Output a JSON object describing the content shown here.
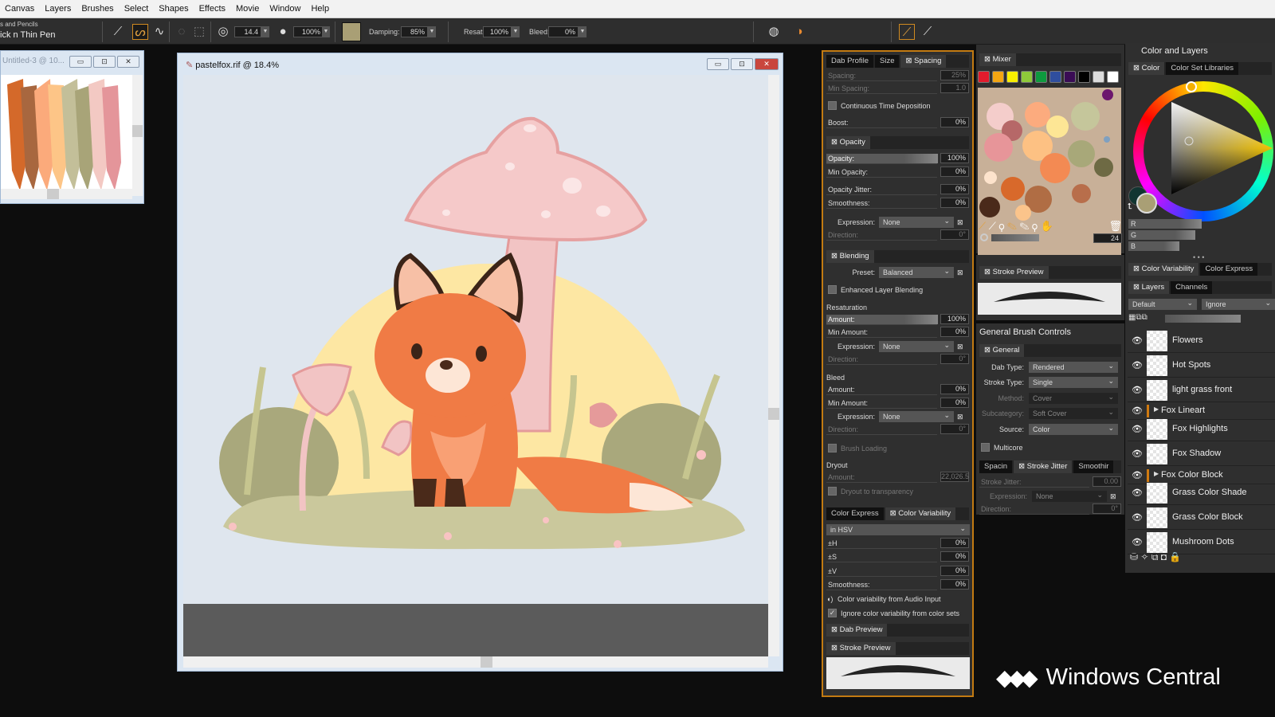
{
  "menu": [
    "Canvas",
    "Layers",
    "Brushes",
    "Select",
    "Shapes",
    "Effects",
    "Movie",
    "Window",
    "Help"
  ],
  "toolbar": {
    "brush_category": "s and Pencils",
    "brush_variant": "ick n Thin Pen",
    "size": "14.4",
    "opacity": "100%",
    "damping_label": "Damping:",
    "damping": "85%",
    "resat_label": "Resat:",
    "resat": "100%",
    "bleed_label": "Bleed:",
    "bleed": "0%",
    "current_color": "#a99f75"
  },
  "small_window": {
    "title": "Untitled-3 @ 10...",
    "strokes": [
      "#d4692a",
      "#a8673f",
      "#fbaa7b",
      "#fdc587",
      "#c3bf99",
      "#a8a478",
      "#f3c9c3",
      "#e4959a"
    ]
  },
  "main_window": {
    "title": "pastelfox.rif @ 18.4%"
  },
  "brush_panel": {
    "rows": [
      {
        "t": "tabs",
        "tabs": [
          "Dab Profile",
          "Size",
          "Spacing"
        ],
        "active": 2
      },
      {
        "t": "field",
        "label": "Spacing:",
        "value": "25%",
        "dim": true
      },
      {
        "t": "field",
        "label": "Min Spacing:",
        "value": "1.0",
        "dim": true
      },
      {
        "t": "check",
        "label": "Continuous Time Deposition"
      },
      {
        "t": "field",
        "label": "Boost:",
        "value": "0%"
      },
      {
        "t": "tabs",
        "tabs": [
          "Opacity"
        ],
        "active": 0
      },
      {
        "t": "slider",
        "label": "Opacity:",
        "value": "100%",
        "fill": 1
      },
      {
        "t": "field",
        "label": "Min Opacity:",
        "value": "0%"
      },
      {
        "t": "field",
        "label": "Opacity Jitter:",
        "value": "0%"
      },
      {
        "t": "field",
        "label": "Smoothness:",
        "value": "0%"
      },
      {
        "t": "select",
        "label": "Expression:",
        "value": "None"
      },
      {
        "t": "field",
        "label": "Direction:",
        "value": "0°",
        "dim": true
      },
      {
        "t": "tabs",
        "tabs": [
          "Blending"
        ],
        "active": 0
      },
      {
        "t": "select",
        "label": "Preset:",
        "value": "Balanced"
      },
      {
        "t": "check",
        "label": "Enhanced Layer Blending"
      },
      {
        "t": "heading",
        "label": "Resaturation"
      },
      {
        "t": "slider",
        "label": "Amount:",
        "value": "100%",
        "fill": 1
      },
      {
        "t": "field",
        "label": "Min Amount:",
        "value": "0%"
      },
      {
        "t": "select",
        "label": "Expression:",
        "value": "None"
      },
      {
        "t": "field",
        "label": "Direction:",
        "value": "0°",
        "dim": true
      },
      {
        "t": "heading",
        "label": "Bleed"
      },
      {
        "t": "field",
        "label": "Amount:",
        "value": "0%"
      },
      {
        "t": "field",
        "label": "Min Amount:",
        "value": "0%"
      },
      {
        "t": "select",
        "label": "Expression:",
        "value": "None"
      },
      {
        "t": "field",
        "label": "Direction:",
        "value": "0°",
        "dim": true
      },
      {
        "t": "check",
        "label": "Brush Loading",
        "dim": true
      },
      {
        "t": "heading",
        "label": "Dryout"
      },
      {
        "t": "field",
        "label": "Amount:",
        "value": "22,026.5",
        "dim": true
      },
      {
        "t": "check",
        "label": "Dryout to transparency",
        "dim": true
      },
      {
        "t": "tabs",
        "tabs": [
          "Color Express",
          "Color Variability"
        ],
        "active": 1
      },
      {
        "t": "select",
        "label": "",
        "value": "in HSV"
      },
      {
        "t": "field",
        "label": "±H",
        "value": "0%"
      },
      {
        "t": "field",
        "label": "±S",
        "value": "0%"
      },
      {
        "t": "field",
        "label": "±V",
        "value": "0%"
      },
      {
        "t": "field",
        "label": "Smoothness:",
        "value": "0%"
      },
      {
        "t": "audio",
        "label": "Color variability from Audio Input"
      },
      {
        "t": "check",
        "label": "Ignore color variability from color sets",
        "checked": true
      },
      {
        "t": "tabs",
        "tabs": [
          "Dab Preview"
        ],
        "active": 0
      },
      {
        "t": "tabs",
        "tabs": [
          "Stroke Preview"
        ],
        "active": 0
      }
    ]
  },
  "mixer": {
    "tab": "Mixer",
    "swatches": [
      "#e21b2c",
      "#f3a512",
      "#f8ee00",
      "#8fc93a",
      "#0e9a3e",
      "#2f4e9e",
      "#3a0c55",
      "#000000",
      "#dcdcdc",
      "#ffffff"
    ],
    "brush_size": "24",
    "stroke_preview_tab": "Stroke Preview"
  },
  "general": {
    "title": "General Brush Controls",
    "rows": [
      {
        "t": "tabs",
        "tabs": [
          "General"
        ],
        "active": 0
      },
      {
        "t": "gselect",
        "label": "Dab Type:",
        "value": "Rendered"
      },
      {
        "t": "gselect",
        "label": "Stroke Type:",
        "value": "Single"
      },
      {
        "t": "gselect",
        "label": "Method:",
        "value": "Cover",
        "dim": true
      },
      {
        "t": "gselect",
        "label": "Subcategory:",
        "value": "Soft Cover",
        "dim": true
      },
      {
        "t": "gselect",
        "label": "Source:",
        "value": "Color"
      },
      {
        "t": "check",
        "label": "Multicore"
      },
      {
        "t": "tabs",
        "tabs": [
          "Spacin",
          "Stroke Jitter",
          "Smoothir"
        ],
        "active": 1
      },
      {
        "t": "field",
        "label": "Stroke Jitter:",
        "value": "0.00",
        "dim": true
      },
      {
        "t": "select",
        "label": "Expression:",
        "value": "None",
        "dim": true
      },
      {
        "t": "field",
        "label": "Direction:",
        "value": "0°",
        "dim": true
      }
    ]
  },
  "color_layers": {
    "title": "Color and Layers",
    "color_tabs": [
      "Color",
      "Color Set Libraries"
    ],
    "rgb_labels": [
      "R",
      "G",
      "B"
    ],
    "rgb_fill": [
      0.66,
      0.6,
      0.46
    ],
    "main_color": "#a99f75",
    "secondary_color": "#113531",
    "variability_tabs": [
      "Color Variability",
      "Color Express"
    ],
    "layer_tabs": [
      "Layers",
      "Channels"
    ],
    "composite_method": "Default",
    "composite_depth": "Ignore",
    "layers": [
      {
        "name": "Flowers"
      },
      {
        "name": "Hot Spots"
      },
      {
        "name": "light grass front"
      },
      {
        "name": "Fox Lineart",
        "group": true
      },
      {
        "name": "Fox Highlights"
      },
      {
        "name": "Fox Shadow"
      },
      {
        "name": "Fox Color Block",
        "group": true
      },
      {
        "name": "Grass Color Shade"
      },
      {
        "name": "Grass Color Block"
      },
      {
        "name": "Mushroom Dots"
      }
    ]
  },
  "watermark": "Windows Central"
}
